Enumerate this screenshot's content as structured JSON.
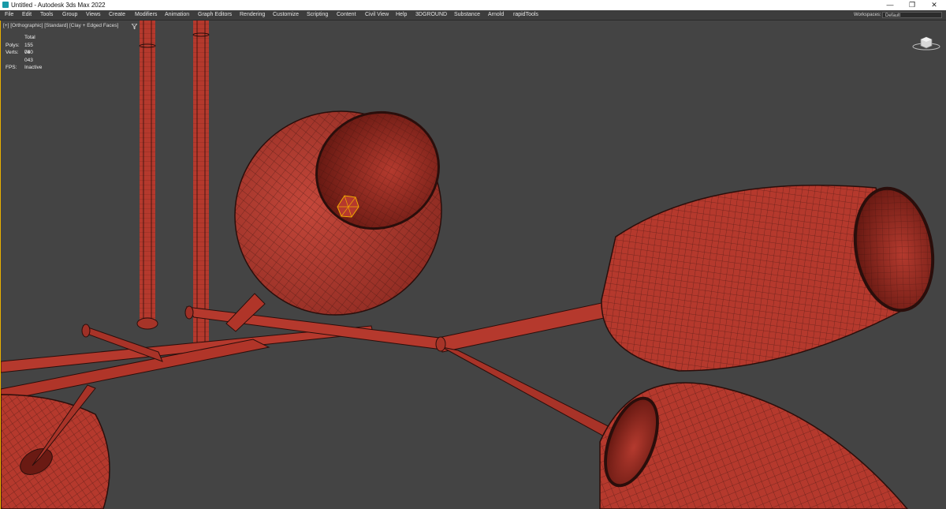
{
  "window": {
    "title": "Untitled - Autodesk 3ds Max 2022",
    "controls": {
      "minimize": "—",
      "restore": "❐",
      "close": "✕"
    }
  },
  "menubar": {
    "items": [
      "File",
      "Edit",
      "Tools",
      "Group",
      "Views",
      "Create",
      "Modifiers",
      "Animation",
      "Graph Editors",
      "Rendering",
      "Customize",
      "Scripting",
      "Content",
      "Civil View",
      "Help",
      "3DGROUND",
      "Substance",
      "Arnold",
      "rapidTools"
    ],
    "workspaces_label": "Workspaces:",
    "workspace_value": "Default"
  },
  "viewport": {
    "label": "[+] [Orthographic] [Standard] [Clay + Edged Faces]",
    "filter_icon": "funnel-icon",
    "stats": {
      "header": "Total",
      "polys_label": "Polys:",
      "polys_value": "155 040",
      "verts_label": "Verts:",
      "verts_value": "78 043",
      "fps_label": "FPS:",
      "fps_value": "Inactive"
    },
    "viewcube_icon": "viewcube-icon",
    "colors": {
      "background": "#444444",
      "clay": "#b5392d",
      "clay_dark": "#7a1f18",
      "wire": "#2a0e0b",
      "selection": "#f2a900"
    }
  }
}
